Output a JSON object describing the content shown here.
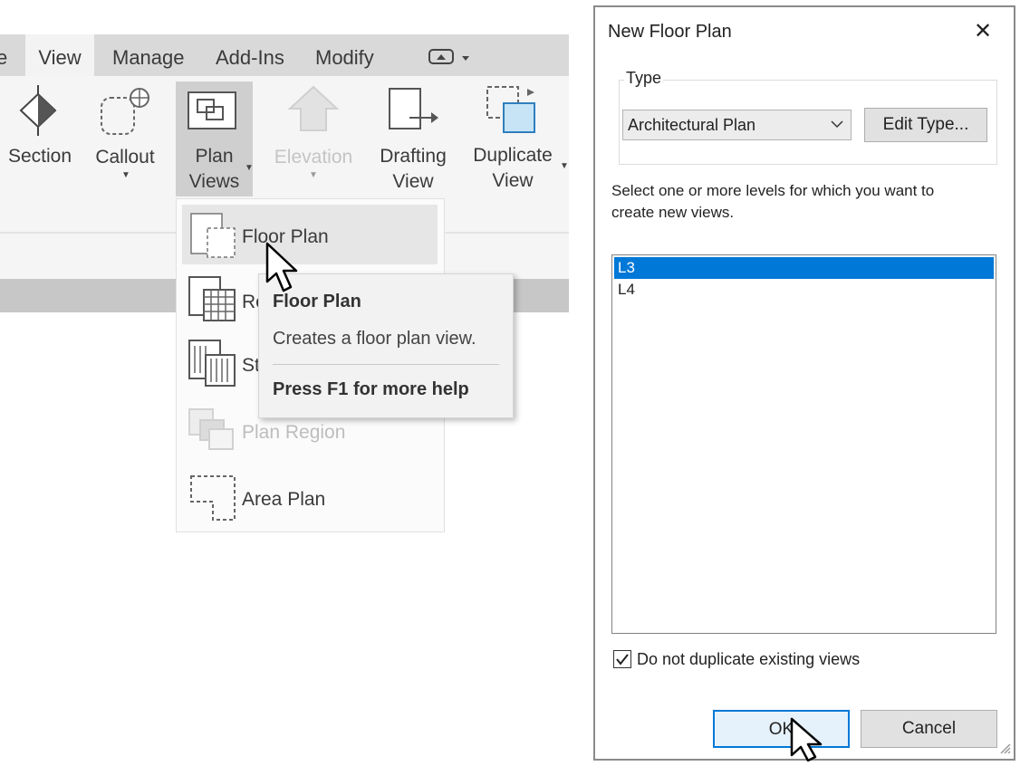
{
  "ribbon": {
    "tabs": [
      "e",
      "View",
      "Manage",
      "Add-Ins",
      "Modify"
    ],
    "active_tab": "View",
    "buttons": {
      "section": "Section",
      "callout": "Callout",
      "plan_views_1": "Plan",
      "plan_views_2": "Views",
      "elevation": "Elevation",
      "drafting_1": "Drafting",
      "drafting_2": "View",
      "duplicate_1": "Duplicate",
      "duplicate_2": "View"
    }
  },
  "dropdown": {
    "items": [
      {
        "label": "Floor Plan",
        "enabled": true
      },
      {
        "label": "Re",
        "enabled": true
      },
      {
        "label": "St",
        "enabled": true
      },
      {
        "label": "Plan Region",
        "enabled": false
      },
      {
        "label": "Area Plan",
        "enabled": true
      }
    ]
  },
  "tooltip": {
    "title": "Floor Plan",
    "description": "Creates a floor plan view.",
    "help": "Press F1 for more help"
  },
  "dialog": {
    "title": "New Floor Plan",
    "close_glyph": "✕",
    "type_group_label": "Type",
    "type_value": "Architectural Plan",
    "edit_type_label": "Edit Type...",
    "instructions_line1": "Select one or more levels for which you want to",
    "instructions_line2": "create new views.",
    "levels": [
      "L3",
      "L4"
    ],
    "selected_level": "L3",
    "checkbox_label": "Do not duplicate existing views",
    "checkbox_checked": true,
    "ok_label": "OK",
    "cancel_label": "Cancel"
  },
  "colors": {
    "selection": "#0078d7",
    "ribbon_bg": "#f5f5f5",
    "tabbar_bg": "#d9d9d9"
  }
}
